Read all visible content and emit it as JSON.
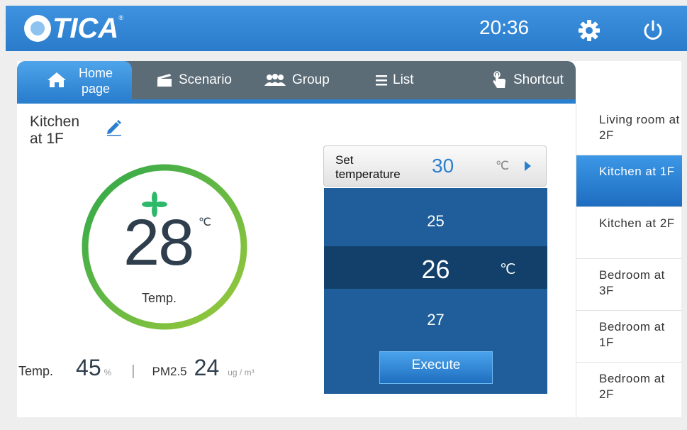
{
  "header": {
    "brand": "TICA",
    "brand_mark": "®",
    "time": "20:36"
  },
  "tabs": [
    {
      "label": "Home page",
      "icon": "home-icon",
      "active": true
    },
    {
      "label": "Scenario",
      "icon": "clapperboard-icon"
    },
    {
      "label": "Group",
      "icon": "group-icon"
    },
    {
      "label": "List",
      "icon": "list-icon"
    },
    {
      "label": "Shortcut",
      "icon": "hand-pointer-icon"
    }
  ],
  "room": {
    "title": "Kitchen at 1F",
    "current_temp": "28",
    "temp_unit": "℃",
    "temp_label": "Temp."
  },
  "stats": {
    "humidity_label": "Temp.",
    "humidity_value": "45",
    "humidity_unit": "%",
    "separator": "|",
    "pm_label": "PM2.5",
    "pm_value": "24",
    "pm_unit": "ug / m³"
  },
  "set_temperature": {
    "label": "Set temperature",
    "value": "30",
    "unit": "℃"
  },
  "picker": {
    "options": [
      "25",
      "26",
      "27"
    ],
    "selected": "26",
    "unit": "℃",
    "execute_label": "Execute"
  },
  "room_list": [
    {
      "label": "Living room at 2F",
      "active": false
    },
    {
      "label": "Kitchen at 1F",
      "active": true
    },
    {
      "label": "Kitchen at 2F",
      "active": false
    },
    {
      "label": "Bedroom at 3F",
      "active": false
    },
    {
      "label": "Bedroom at 1F",
      "active": false
    },
    {
      "label": "Bedroom at 2F",
      "active": false
    }
  ],
  "colors": {
    "header_blue": "#2a7ccb",
    "accent_blue": "#2b7fcf",
    "gauge_green": "#5cb85c",
    "picker_blue": "#1f5e9a"
  }
}
